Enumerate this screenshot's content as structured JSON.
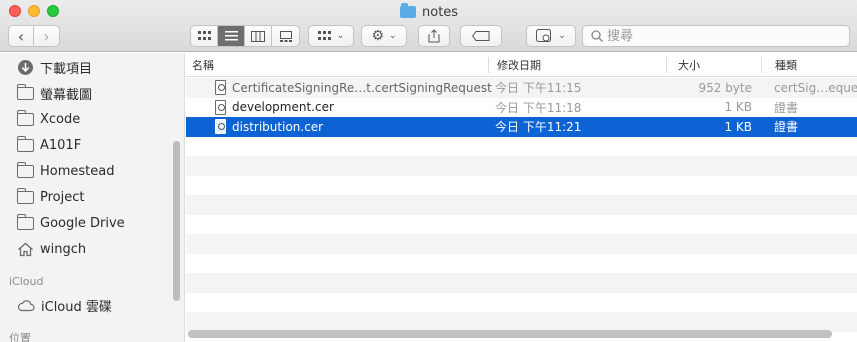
{
  "window": {
    "title": "notes"
  },
  "toolbar": {
    "search_placeholder": "搜尋"
  },
  "sidebar": {
    "items": [
      {
        "label": "下載項目",
        "icon": "download-icon"
      },
      {
        "label": "螢幕截圖",
        "icon": "folder-icon"
      },
      {
        "label": "Xcode",
        "icon": "folder-icon"
      },
      {
        "label": "A101F",
        "icon": "folder-icon"
      },
      {
        "label": "Homestead",
        "icon": "folder-icon"
      },
      {
        "label": "Project",
        "icon": "folder-icon"
      },
      {
        "label": "Google Drive",
        "icon": "folder-icon"
      },
      {
        "label": "wingch",
        "icon": "home-icon"
      }
    ],
    "sections": {
      "icloud": "iCloud",
      "locations": "位置"
    },
    "icloud_items": [
      {
        "label": "iCloud 雲碟",
        "icon": "cloud-icon"
      }
    ]
  },
  "list": {
    "columns": {
      "name": "名稱",
      "date": "修改日期",
      "size": "大小",
      "kind": "種類"
    },
    "rows": [
      {
        "name": "CertificateSigningRe…t.certSigningRequest",
        "date": "今日 下午11:15",
        "size": "952 byte",
        "kind": "certSig…eques",
        "selected": false,
        "dim": true
      },
      {
        "name": "development.cer",
        "date": "今日 下午11:18",
        "size": "1 KB",
        "kind": "證書",
        "selected": false,
        "dim": false
      },
      {
        "name": "distribution.cer",
        "date": "今日 下午11:21",
        "size": "1 KB",
        "kind": "證書",
        "selected": true,
        "dim": false
      }
    ]
  },
  "colors": {
    "selection": "#0e63d4",
    "close": "#fe5f57",
    "minimize": "#febc2e",
    "zoom": "#28c840"
  }
}
